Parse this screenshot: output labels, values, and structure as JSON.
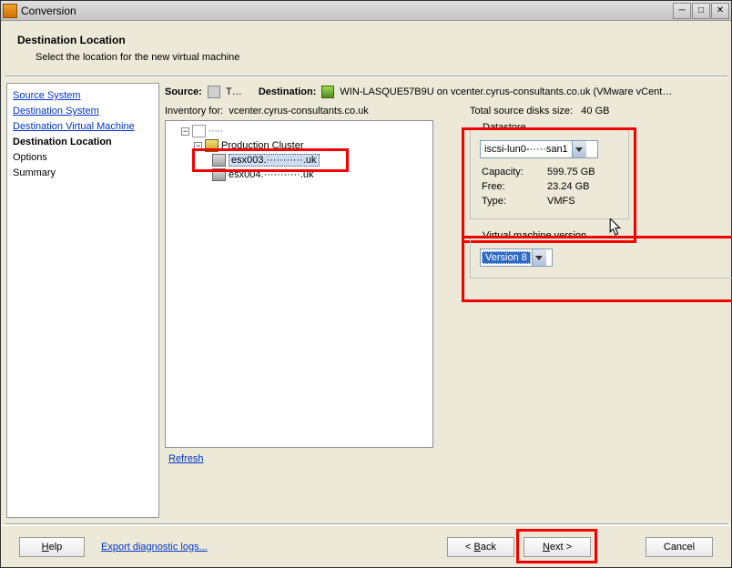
{
  "window_title": "Conversion",
  "header": {
    "title": "Destination Location",
    "subtitle": "Select the location for the new virtual machine"
  },
  "sidebar": {
    "items": [
      {
        "label": "Source System",
        "type": "link"
      },
      {
        "label": "Destination System",
        "type": "link"
      },
      {
        "label": "Destination Virtual Machine",
        "type": "link"
      },
      {
        "label": "Destination Location",
        "type": "current"
      },
      {
        "label": "Options",
        "type": "plain"
      },
      {
        "label": "Summary",
        "type": "plain"
      }
    ]
  },
  "src_dest": {
    "source_label": "Source:",
    "source_text": "T…",
    "dest_label": "Destination:",
    "dest_text": "WIN-LASQUE57B9U on vcenter.cyrus-consultants.co.uk (VMware vCent…"
  },
  "inventory": {
    "label": "Inventory for:",
    "host": "vcenter.cyrus-consultants.co.uk",
    "tree": {
      "datacenter": "·····",
      "cluster": "Production Cluster",
      "host1": "esx003.···········.uk",
      "host2": "esx004.···········.uk"
    }
  },
  "disk_info": {
    "label": "Total source disks size:",
    "value": "40 GB"
  },
  "datastore": {
    "legend": "Datastore",
    "selected": "iscsi-lun0-·····san1",
    "capacity_label": "Capacity:",
    "capacity_value": "599.75 GB",
    "free_label": "Free:",
    "free_value": "23.24 GB",
    "type_label": "Type:",
    "type_value": "VMFS"
  },
  "vm_version": {
    "legend": "Virtual machine version",
    "selected": "Version 8"
  },
  "refresh_label": "Refresh",
  "footer": {
    "help": "Help",
    "diag": "Export diagnostic logs...",
    "back": "< Back",
    "next": "Next >",
    "cancel": "Cancel"
  }
}
